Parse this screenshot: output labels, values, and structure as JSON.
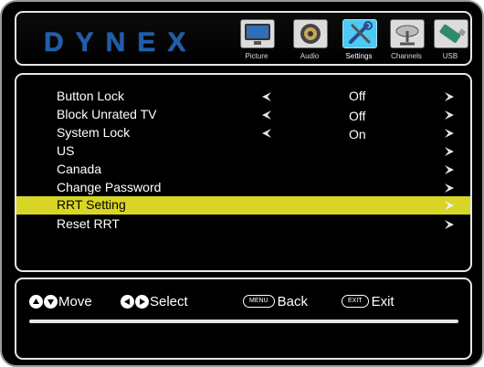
{
  "header": {
    "brand": "DYNEX",
    "tabs": [
      {
        "label": "Picture",
        "icon": "tv-icon",
        "active": false
      },
      {
        "label": "Audio",
        "icon": "speaker-icon",
        "active": false
      },
      {
        "label": "Settings",
        "icon": "tools-icon",
        "active": true
      },
      {
        "label": "Channels",
        "icon": "satellite-dish-icon",
        "active": false
      },
      {
        "label": "USB",
        "icon": "usb-drive-icon",
        "active": false
      }
    ]
  },
  "menu": {
    "items": [
      {
        "label": "Button Lock",
        "value": "Off",
        "left_arrow": true
      },
      {
        "label": "Block Unrated TV",
        "value": "Off",
        "left_arrow": true
      },
      {
        "label": "System Lock",
        "value": "On",
        "left_arrow": true
      },
      {
        "label": "US",
        "value": "",
        "left_arrow": false
      },
      {
        "label": "Canada",
        "value": "",
        "left_arrow": false
      },
      {
        "label": "Change Password",
        "value": "",
        "left_arrow": false
      },
      {
        "label": "RRT Setting",
        "value": "",
        "left_arrow": false,
        "highlighted": true
      },
      {
        "label": "Reset RRT",
        "value": "",
        "left_arrow": false
      }
    ],
    "highlight_color": "#d8d526"
  },
  "footer": {
    "move": "Move",
    "select": "Select",
    "menu_key": "MENU",
    "back": "Back",
    "exit_key": "EXIT",
    "exit": "Exit"
  },
  "colors": {
    "brand": "#1d5eb0",
    "active_tab": "#4fc8f4",
    "border": "#e6e6e6"
  }
}
